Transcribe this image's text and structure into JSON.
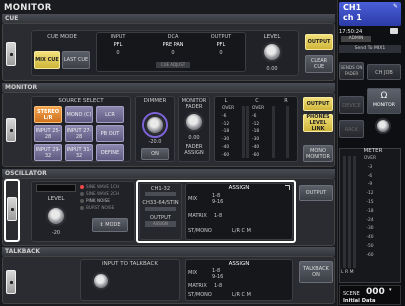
{
  "title": "MONITOR",
  "cue": {
    "section": "CUE",
    "mode_label": "CUE MODE",
    "mix_cue": "MIX CUE",
    "last_cue": "LAST CUE",
    "input_label": "INPUT",
    "input_val": "PFL",
    "dca_label": "DCA",
    "dca_val": "PRE PAN",
    "dca_sub": "CUE ADJUST",
    "output_label": "OUTPUT",
    "output_val": "PFL",
    "zero": "0",
    "level_label": "LEVEL",
    "level_val": "0.00",
    "output_btn": "OUTPUT",
    "clear_cue": "CLEAR CUE"
  },
  "monitor": {
    "section": "MONITOR",
    "source_select": "SOURCE SELECT",
    "stereo": "STEREO L/R",
    "mono": "MONO (C)",
    "lcr": "LCR",
    "input_2528": "INPUT 25-28",
    "input_2728": "INPUT 27-28",
    "pb_out": "PB OUT",
    "input_2932": "INPUT 29-32",
    "input_3132": "INPUT 31-32",
    "define": "DEFINE",
    "dimmer": "DIMMER",
    "dimmer_val": "-20.0",
    "on": "ON",
    "monitor_fader": "MONITOR FADER",
    "fader_val": "0.00",
    "fader_assign": "FADER ASSIGN",
    "meter_l": "L",
    "meter_c": "C",
    "meter_r": "R",
    "meter_scale": [
      "OVER",
      "-6",
      "-12",
      "-18",
      "-30",
      "-40",
      "-60"
    ],
    "output_btn": "OUTPUT",
    "phones": "PHONES LEVEL LINK",
    "mono_monitor": "MONO MONITOR"
  },
  "oscillator": {
    "section": "OSCILLATOR",
    "level": "LEVEL",
    "level_val": "-20",
    "modes": [
      "SINE WAVE 1CH",
      "SINE WAVE 2CH",
      "PINK NOISE",
      "BURST NOISE"
    ],
    "mode_btn": "MODE",
    "ch_a": "CH1-32",
    "ch_b": "CH33-64/STIN",
    "output": "OUTPUT",
    "output_sub": "ASSIGN",
    "assign": "ASSIGN",
    "mix": "MIX",
    "mix_ranges": [
      "1-8",
      "9-16"
    ],
    "matrix": "MATRIX",
    "matrix_range": "1-8",
    "st_mono": "ST/MONO",
    "st_vals": "L/R  C  M",
    "output_btn": "OUTPUT"
  },
  "talkback": {
    "section": "TALKBACK",
    "input_to_talkback": "INPUT TO TALKBACK",
    "assign": "ASSIGN",
    "mix": "MIX",
    "mix_ranges": [
      "1-8",
      "9-16"
    ],
    "matrix": "MATRIX",
    "matrix_range": "1-8",
    "st_mono": "ST/MONO",
    "st_vals": "L/R  C  M",
    "talkback_on": "TALKBACK ON"
  },
  "sidebar": {
    "ch_name": "CH1",
    "ch_sub": "ch 1",
    "time": "17:50:24",
    "user": "ADMIN",
    "send_to": "Send To MIX1",
    "sends_on_fader": "SENDS ON FADER",
    "ch_job": "CH JOB",
    "device": "DEVICE",
    "monitor": "MONITOR",
    "rack": "RACK",
    "meter": "METER",
    "meter_scale": [
      "OVER",
      "-3",
      "-6",
      "-9",
      "-12",
      "-15",
      "-18",
      "-24",
      "-30",
      "-40",
      "-50",
      "-60"
    ],
    "meter_lrm": "L  R  M",
    "setup": "SETUP",
    "scene_label": "SCENE",
    "scene_num": "000",
    "scene_name": "Initial Data"
  }
}
